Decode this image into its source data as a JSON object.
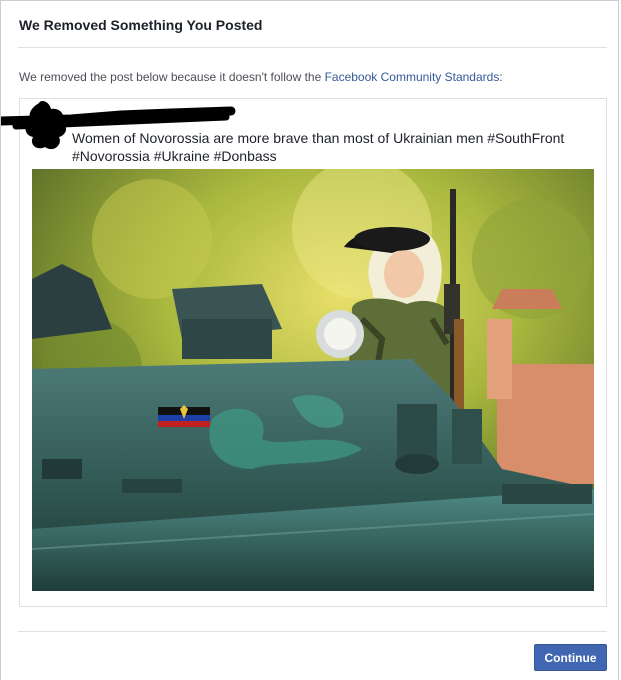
{
  "dialog": {
    "title": "We Removed Something You Posted",
    "message_prefix": "We removed the post below because it doesn't follow the ",
    "message_link": "Facebook Community Standards",
    "message_suffix": ":"
  },
  "post": {
    "author_redacted": true,
    "text": "Women of Novorossia are more brave than most of Ukrainian men #SouthFront #Novorossia #Ukraine #Donbass",
    "image_subject": "woman-on-armored-vehicle-photo"
  },
  "footer": {
    "continue_label": "Continue"
  },
  "colors": {
    "link": "#365899",
    "button": "#4267b2",
    "divider": "#dddfe2"
  }
}
